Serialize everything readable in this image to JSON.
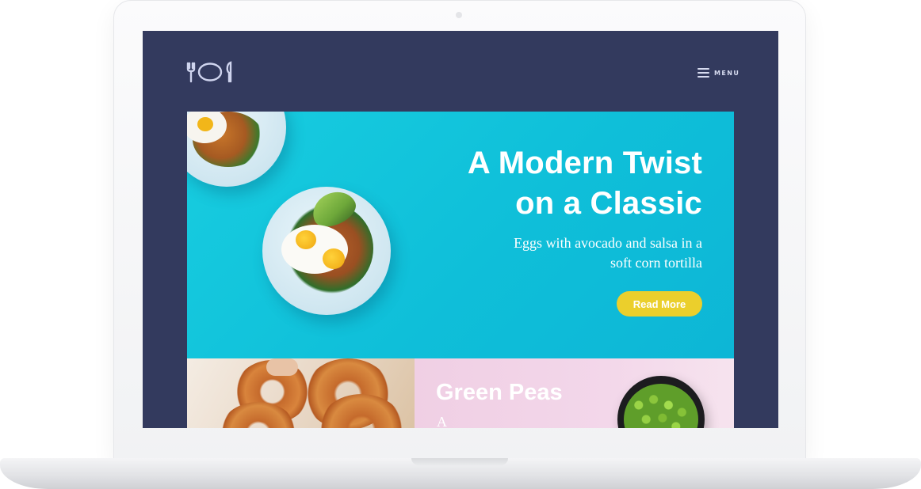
{
  "nav": {
    "menu_label": "MENU"
  },
  "hero": {
    "title_line1": "A Modern Twist",
    "title_line2": "on a Classic",
    "subtitle_line1": "Eggs with avocado and salsa in a",
    "subtitle_line2": "soft corn tortilla",
    "cta_label": "Read More"
  },
  "cards": [
    {
      "title": "",
      "image": "donuts"
    },
    {
      "title": "Green Peas",
      "description_partial": "A",
      "image": "peas-bowl"
    }
  ],
  "colors": {
    "site_background": "#333a5e",
    "hero_background": "#14c4dc",
    "cta_button": "#ebcf2c",
    "peas_card_background": "#f2d3e7",
    "text_on_color": "#ffffff"
  }
}
